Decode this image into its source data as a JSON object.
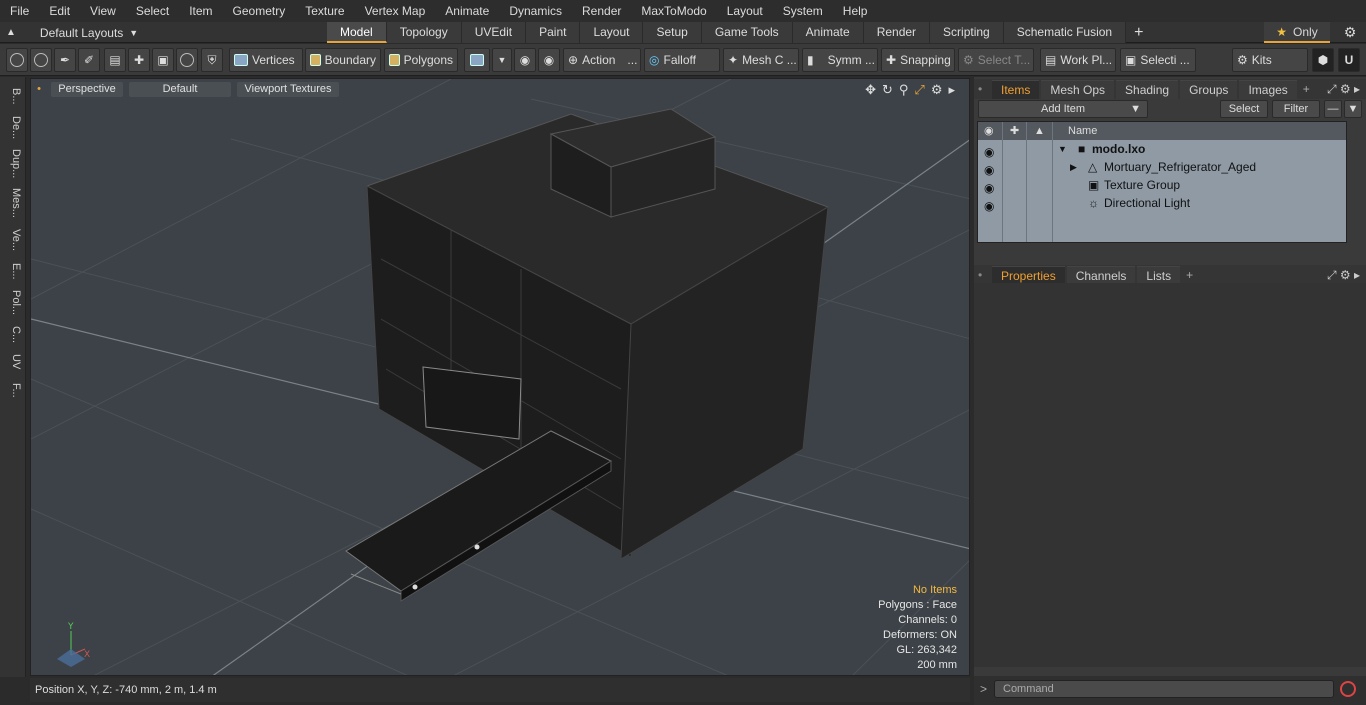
{
  "menu": [
    "File",
    "Edit",
    "View",
    "Select",
    "Item",
    "Geometry",
    "Texture",
    "Vertex Map",
    "Animate",
    "Dynamics",
    "Render",
    "MaxToModo",
    "Layout",
    "System",
    "Help"
  ],
  "layout": {
    "label": "Default Layouts"
  },
  "tabs": [
    "Model",
    "Topology",
    "UVEdit",
    "Paint",
    "Layout",
    "Setup",
    "Game Tools",
    "Animate",
    "Render",
    "Scripting",
    "Schematic Fusion"
  ],
  "active_tab": "Model",
  "only_label": "Only",
  "toolbar": {
    "vertices": "Vertices",
    "boundary": "Boundary",
    "polygons": "Polygons",
    "action": "Action",
    "falloff": "Falloff",
    "meshc": "Mesh C ...",
    "symm": "Symm ...",
    "snapping": "Snapping",
    "selectt": "Select T...",
    "workpl": "Work Pl...",
    "selecti": "Selecti ...",
    "kits": "Kits"
  },
  "leftstrip": [
    "B...",
    "De...",
    "Dup...",
    "Mes...",
    "Ve...",
    "E...",
    "Pol...",
    "C...",
    "UV",
    "F..."
  ],
  "viewport": {
    "perspective": "Perspective",
    "default": "Default",
    "textures": "Viewport Textures",
    "stats": {
      "no_items": "No Items",
      "polygons": "Polygons : Face",
      "channels": "Channels: 0",
      "deformers": "Deformers: ON",
      "gl": "GL: 263,342",
      "scale": "200 mm"
    }
  },
  "status": "Position X, Y, Z:   -740 mm, 2 m, 1.4 m",
  "panel": {
    "tabs": [
      "Items",
      "Mesh Ops",
      "Shading",
      "Groups",
      "Images"
    ],
    "add_item": "Add Item",
    "select": "Select",
    "filter": "Filter",
    "name_col": "Name",
    "items": [
      {
        "label": "modo.lxo"
      },
      {
        "label": "Mortuary_Refrigerator_Aged"
      },
      {
        "label": "Texture Group"
      },
      {
        "label": "Directional Light"
      }
    ],
    "prop_tabs": [
      "Properties",
      "Channels",
      "Lists"
    ],
    "command_placeholder": "Command"
  },
  "colors": {
    "accent": "#e8a33a",
    "viewport_bg": "#3c4247",
    "items_bg": "#8f9aa5"
  }
}
